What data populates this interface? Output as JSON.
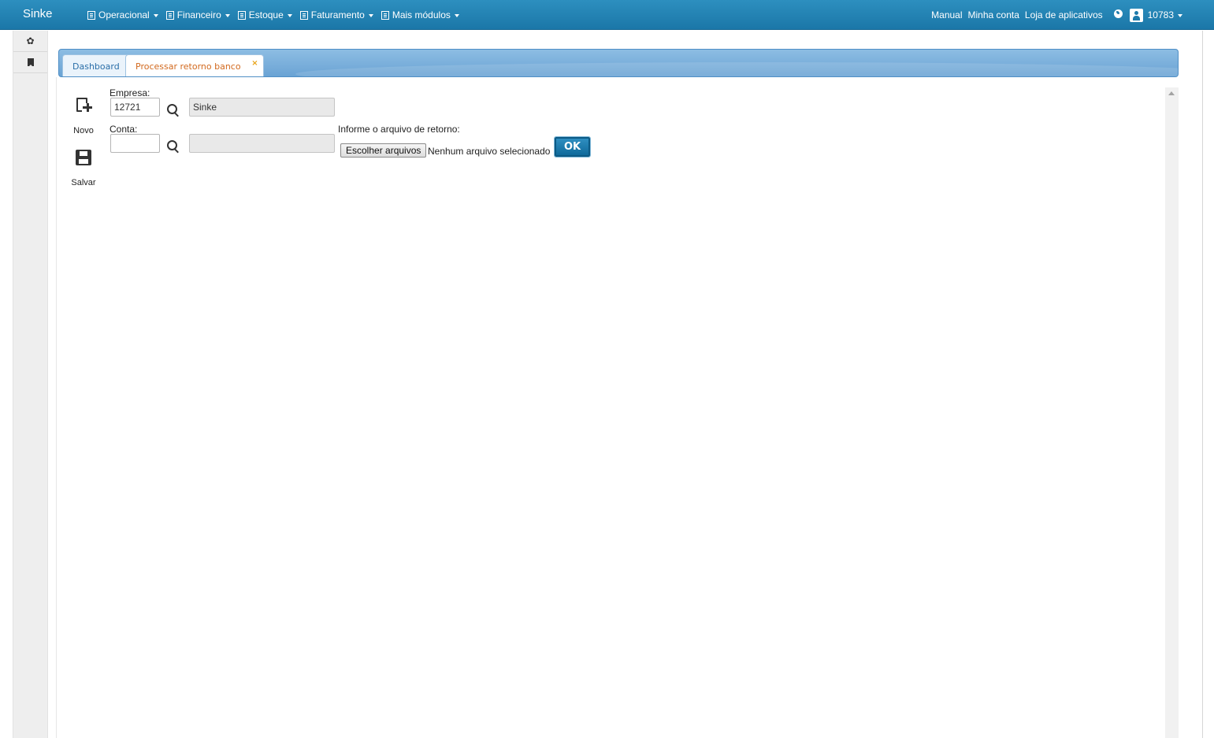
{
  "app": {
    "brand": "Sinke"
  },
  "menu": [
    {
      "label": "Operacional"
    },
    {
      "label": "Financeiro"
    },
    {
      "label": "Estoque"
    },
    {
      "label": "Faturamento"
    },
    {
      "label": "Mais módulos"
    }
  ],
  "top_links": {
    "manual": "Manual",
    "account": "Minha conta",
    "store": "Loja de aplicativos"
  },
  "user": {
    "id": "10783"
  },
  "tabs": {
    "dashboard": "Dashboard",
    "active": "Processar retorno banco",
    "close_glyph": "×"
  },
  "toolbar": {
    "new_label": "Novo",
    "save_label": "Salvar"
  },
  "form": {
    "empresa_label": "Empresa:",
    "empresa_code": "12721",
    "empresa_name": "Sinke",
    "conta_label": "Conta:",
    "conta_code": "",
    "conta_name": "",
    "file_label": "Informe o arquivo de retorno:",
    "file_button": "Escolher arquivos",
    "file_status": "Nenhum arquivo selecionado",
    "ok_label": "OK"
  },
  "colors": {
    "navbar": "#1b77a8",
    "tab_active_text": "#d2691e",
    "tabbar": "#6aa3d4"
  }
}
